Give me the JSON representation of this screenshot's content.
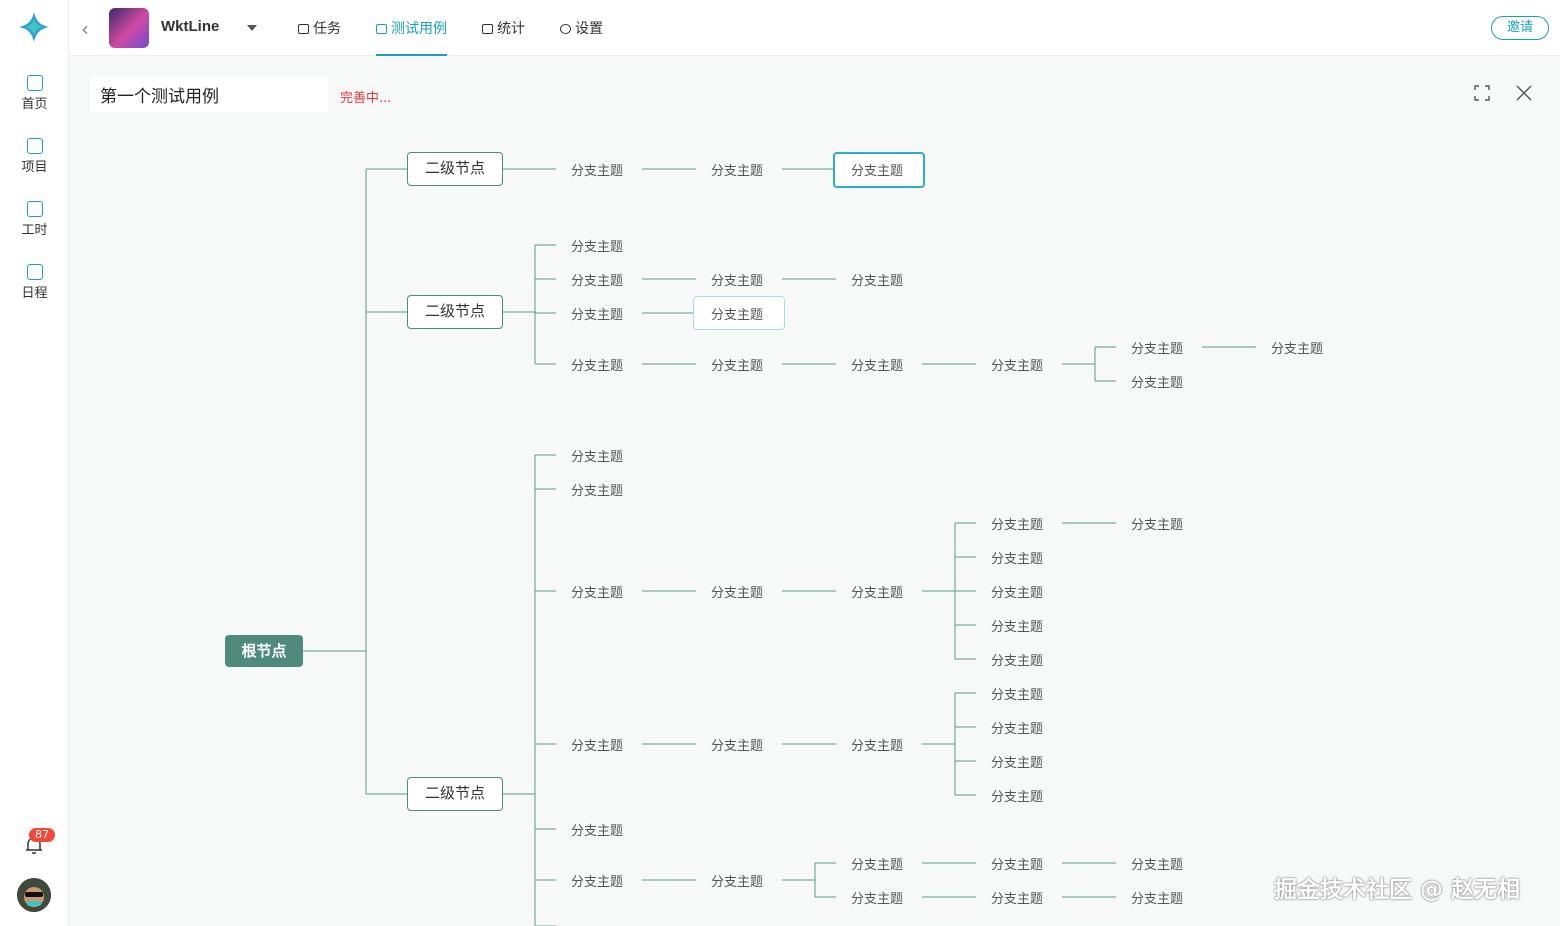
{
  "project": {
    "name": "WktLine"
  },
  "nav": [
    {
      "label": "首页",
      "icon": "home-icon"
    },
    {
      "label": "项目",
      "icon": "project-icon"
    },
    {
      "label": "工时",
      "icon": "calendar-check-icon"
    },
    {
      "label": "日程",
      "icon": "schedule-icon"
    }
  ],
  "tabs": [
    {
      "label": "任务",
      "icon": "monitor-icon",
      "active": false
    },
    {
      "label": "测试用例",
      "icon": "chart-icon",
      "active": true
    },
    {
      "label": "统计",
      "icon": "statistics-icon",
      "active": false
    },
    {
      "label": "设置",
      "icon": "gear-icon",
      "active": false
    }
  ],
  "invite_label": "邀请",
  "notification_count": "87",
  "case": {
    "title": "第一个测试用例",
    "status": "完善中..."
  },
  "mindmap": {
    "root": "根节点",
    "level2": [
      "二级节点",
      "二级节点",
      "二级节点"
    ],
    "branch": "分支主题"
  },
  "watermark": "掘金技术社区 @ 赵无相",
  "colors": {
    "accent": "#17a2b8",
    "node": "#4f8b7c",
    "status": "#e23b3b",
    "badge": "#f5483b"
  }
}
